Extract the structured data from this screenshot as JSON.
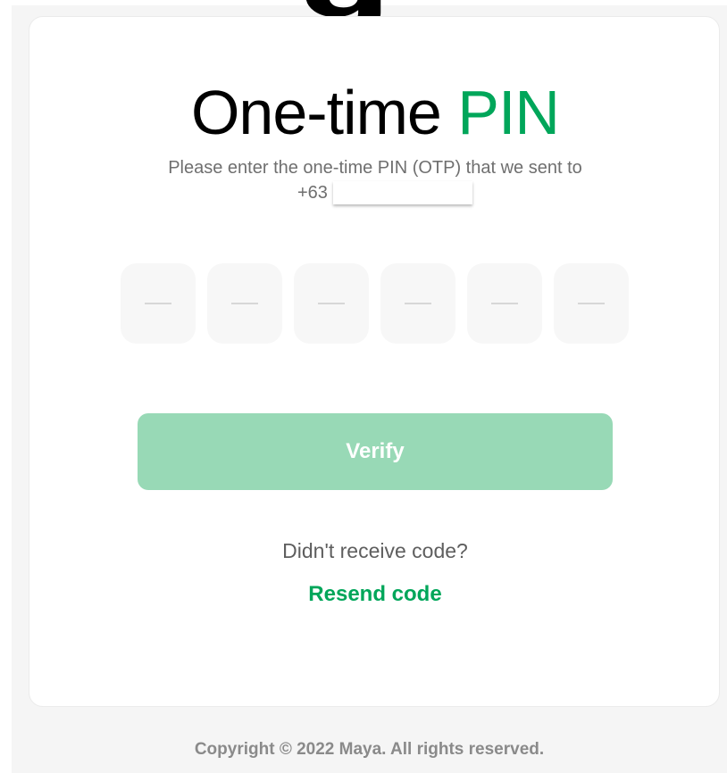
{
  "header": {
    "title_main": "One-time ",
    "title_accent": "PIN"
  },
  "instructions": {
    "line1": "Please enter the one-time PIN (OTP) that we sent to",
    "phone_prefix": "+63"
  },
  "pin": {
    "length": 6,
    "digits": [
      "",
      "",
      "",
      "",
      "",
      ""
    ]
  },
  "actions": {
    "verify_label": "Verify",
    "didnt_receive": "Didn't receive code?",
    "resend_label": "Resend code"
  },
  "footer": {
    "copyright": "Copyright © 2022 Maya. All rights reserved."
  },
  "colors": {
    "accent": "#00a65a",
    "button_disabled": "#98d9b6",
    "page_bg": "#f5f5f5"
  }
}
